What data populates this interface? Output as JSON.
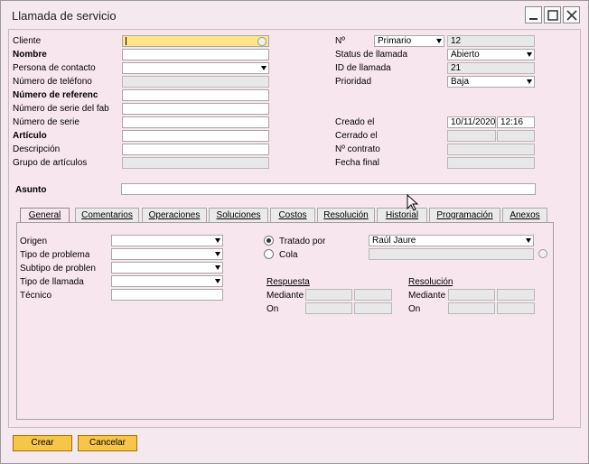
{
  "window": {
    "title": "Llamada de servicio"
  },
  "left_fields": [
    {
      "label": "Cliente",
      "value": ""
    },
    {
      "label": "Nombre",
      "value": ""
    },
    {
      "label": "Persona de contacto",
      "value": ""
    },
    {
      "label": "Número de teléfono",
      "value": ""
    },
    {
      "label": "Número de referenc",
      "value": ""
    },
    {
      "label": "Número de serie del fab",
      "value": ""
    },
    {
      "label": "Número de serie",
      "value": ""
    },
    {
      "label": "Artículo",
      "value": ""
    },
    {
      "label": "Descripción",
      "value": ""
    },
    {
      "label": "Grupo de artículos",
      "value": ""
    }
  ],
  "right_fields": {
    "no_label": "Nº",
    "no_series": "Primario",
    "no_value": "12",
    "status_label": "Status de llamada",
    "status_value": "Abierto",
    "id_label": "ID de llamada",
    "id_value": "21",
    "priority_label": "Prioridad",
    "priority_value": "Baja",
    "created_label": "Creado el",
    "created_date": "10/11/2020",
    "created_time": "12:16",
    "closed_label": "Cerrado el",
    "contract_label": "Nº contrato",
    "end_date_label": "Fecha final"
  },
  "subject": {
    "label": "Asunto",
    "value": ""
  },
  "tabs": [
    {
      "label": "General"
    },
    {
      "label": "Comentarios"
    },
    {
      "label": "Operaciones"
    },
    {
      "label": "Soluciones"
    },
    {
      "label": "Costos"
    },
    {
      "label": "Resolución"
    },
    {
      "label": "Historial"
    },
    {
      "label": "Programación"
    },
    {
      "label": "Anexos"
    }
  ],
  "general": {
    "origin_label": "Origen",
    "problem_type_label": "Tipo de problema",
    "problem_subtype_label": "Subtipo de problen",
    "call_type_label": "Tipo de llamada",
    "technician_label": "Técnico",
    "handled_by_label": "Tratado por",
    "handled_by_value": "Raúl Jaure",
    "queue_label": "Cola",
    "response_label": "Respuesta",
    "resolution_label": "Resolución",
    "via_label": "Mediante",
    "on_label": "On"
  },
  "buttons": {
    "create": "Crear",
    "cancel": "Cancelar"
  }
}
